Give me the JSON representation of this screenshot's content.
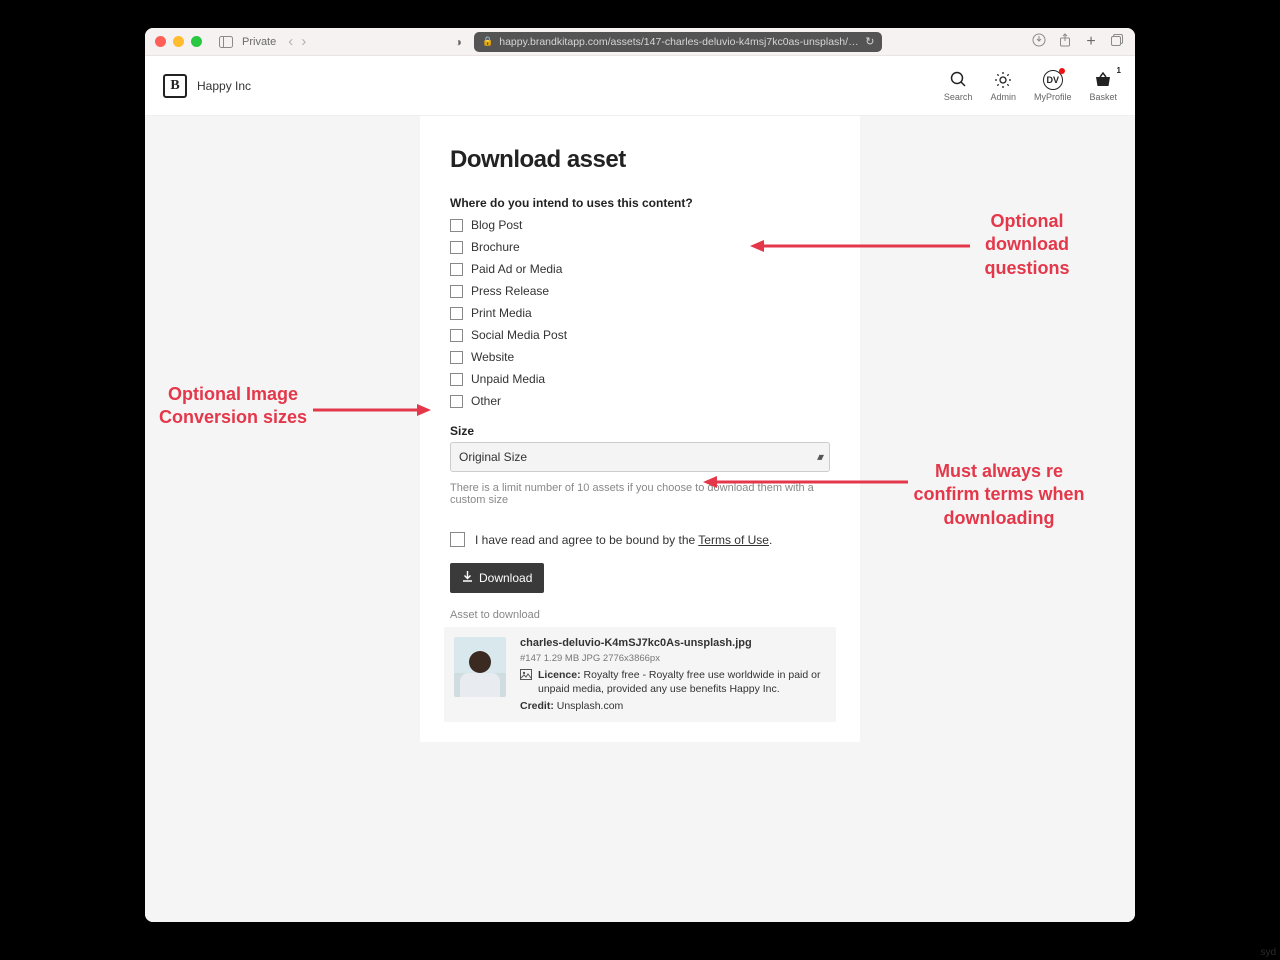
{
  "chrome": {
    "private_label": "Private",
    "url": "happy.brandkitapp.com/assets/147-charles-deluvio-k4msj7kc0as-unsplash/downloads/ne…"
  },
  "header": {
    "brand_logo_letter": "B",
    "brand_name": "Happy Inc",
    "actions": {
      "search": "Search",
      "admin": "Admin",
      "myprofile": "MyProfile",
      "basket": "Basket",
      "avatar_initials": "DV",
      "basket_count": "1"
    }
  },
  "form": {
    "title": "Download asset",
    "question": "Where do you intend to uses this content?",
    "options": [
      "Blog Post",
      "Brochure",
      "Paid Ad or Media",
      "Press Release",
      "Print Media",
      "Social Media Post",
      "Website",
      "Unpaid Media",
      "Other"
    ],
    "size_label": "Size",
    "size_value": "Original Size",
    "size_hint": "There is a limit number of 10 assets if you choose to download them with a custom size",
    "agree_prefix": "I have read and agree to be bound by the ",
    "agree_link": "Terms of Use",
    "agree_suffix": ".",
    "download_label": "Download",
    "asset_to_download": "Asset to download"
  },
  "asset": {
    "filename": "charles-deluvio-K4mSJ7kc0As-unsplash.jpg",
    "meta": "#147 1.29 MB JPG 2776x3866px",
    "licence_label": "Licence:",
    "licence_text": " Royalty free - Royalty free use worldwide in paid or unpaid media, provided any use benefits Happy Inc.",
    "credit_label": "Credit:",
    "credit_text": " Unsplash.com"
  },
  "annotations": {
    "right_top": "Optional download questions",
    "left": "Optional Image Conversion sizes",
    "right_bottom": "Must always re confirm terms when downloading"
  },
  "watermark": "syd"
}
